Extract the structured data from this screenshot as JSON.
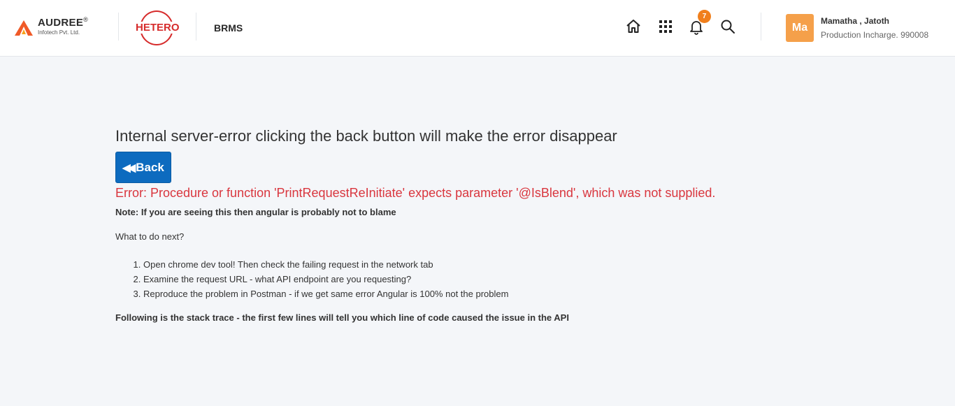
{
  "header": {
    "brand_name": "AUDREE",
    "brand_reg": "®",
    "brand_tagline": "Infotech Pvt. Ltd.",
    "client_logo_text": "HETERO",
    "app_name": "BRMS",
    "notification_count": "7",
    "icons": [
      "home-icon",
      "apps-grid-icon",
      "bell-icon",
      "search-icon"
    ],
    "user": {
      "initials": "Ma",
      "name": "Mamatha , Jatoth",
      "role": "Production Incharge. 990008"
    },
    "accent_color": "#f07f1c"
  },
  "main": {
    "title": "Internal server-error clicking the back button will make the error disappear",
    "back_label": "Back",
    "error_text": "Error: Procedure or function 'PrintRequestReInitiate' expects parameter '@IsBlend', which was not supplied.",
    "note": "Note: If you are seeing this then angular is probably not to blame",
    "next_heading": "What to do next?",
    "steps": [
      "Open chrome dev tool! Then check the failing request in the network tab",
      "Examine the request URL - what API endpoint are you requesting?",
      "Reproduce the problem in Postman - if we get same error Angular is 100% not the problem"
    ],
    "stack_heading": "Following is the stack trace - the first few lines will tell you which line of code caused the issue in the API"
  },
  "colors": {
    "error": "#d9363e",
    "button": "#0d6bbf",
    "background": "#f4f6f9"
  }
}
